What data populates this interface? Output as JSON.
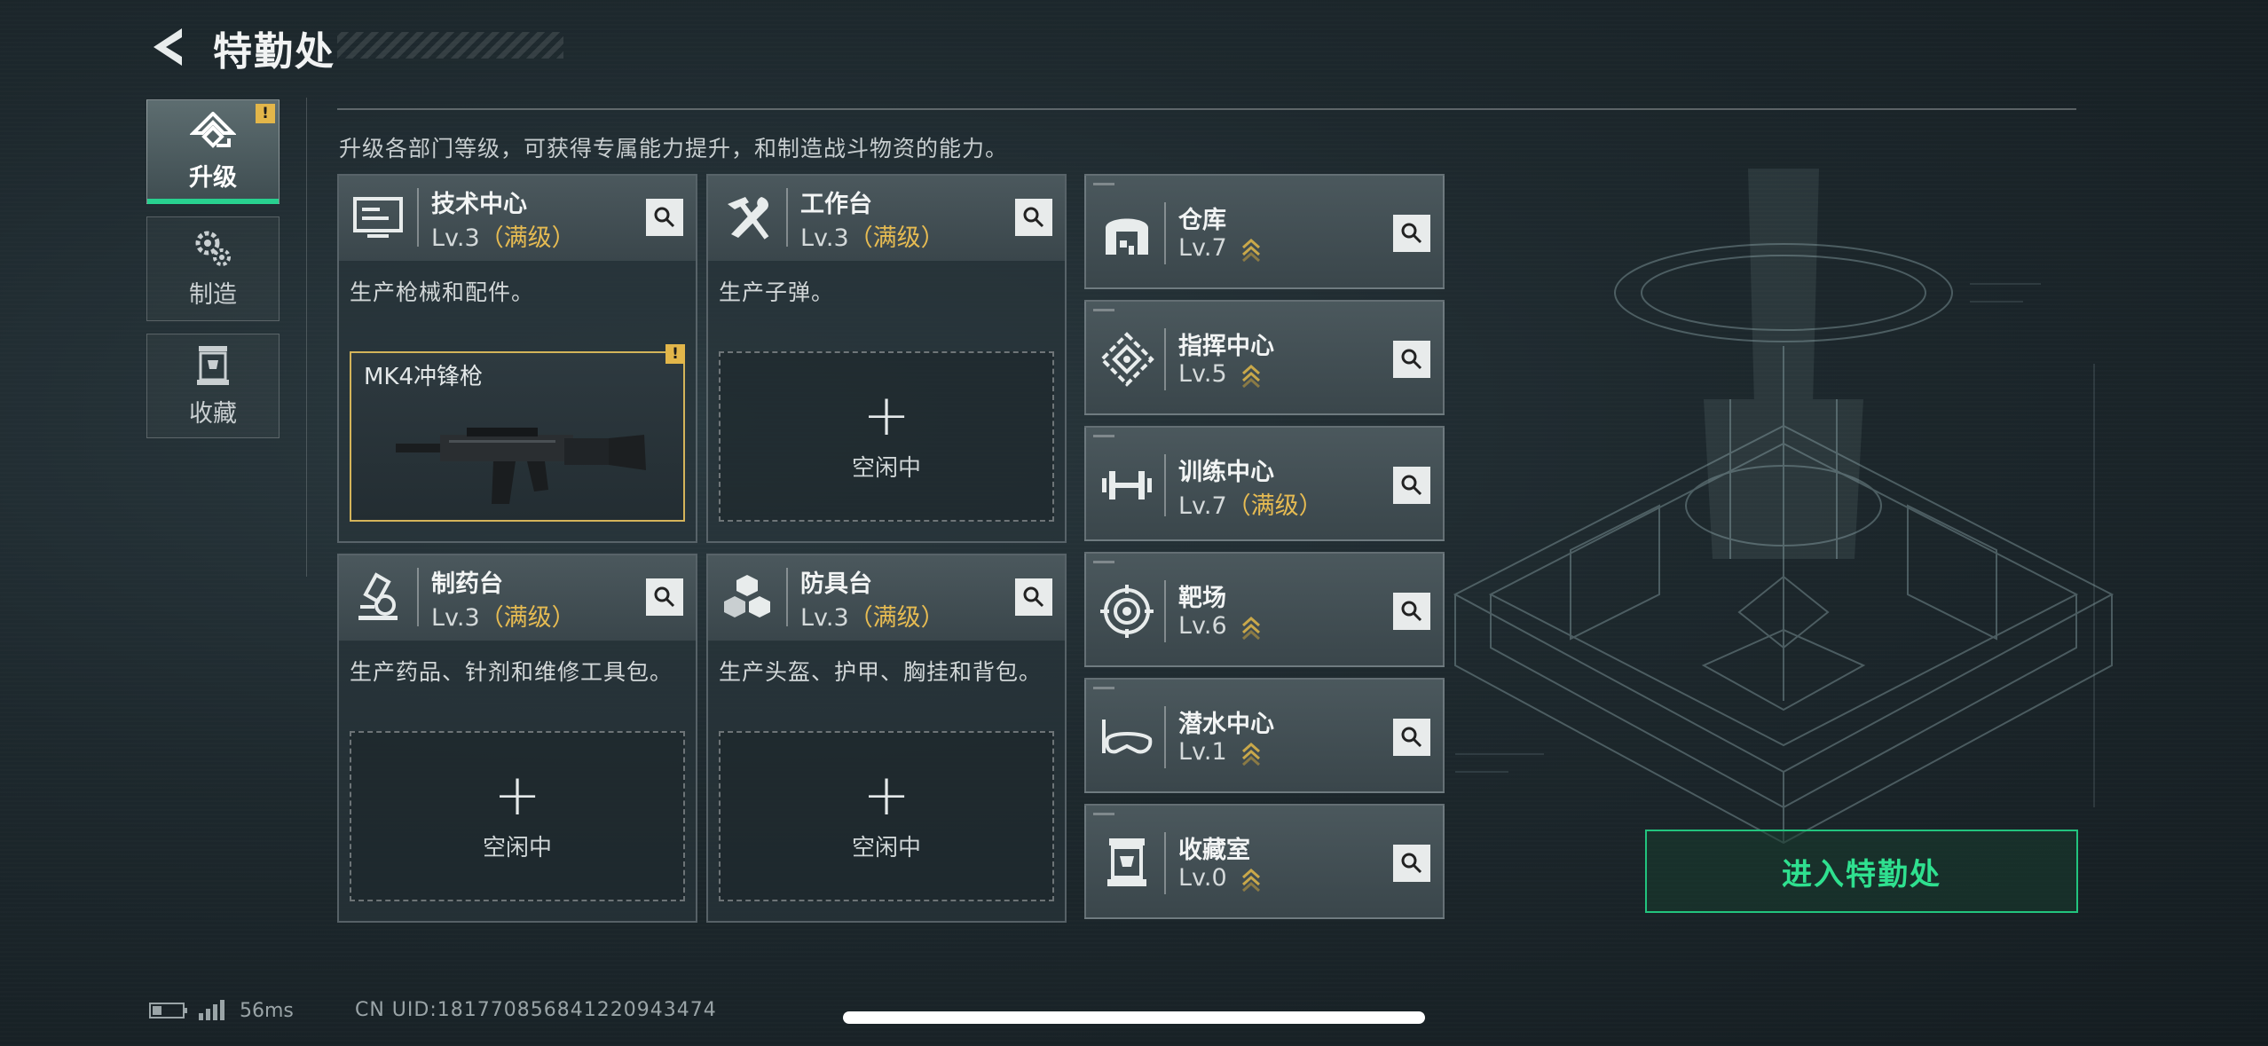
{
  "header": {
    "title": "特勤处"
  },
  "tabs": [
    {
      "label": "升级",
      "icon": "upgrade-icon",
      "active": true,
      "alert": "!"
    },
    {
      "label": "制造",
      "icon": "gears-icon",
      "active": false
    },
    {
      "label": "收藏",
      "icon": "trophy-case-icon",
      "active": false
    }
  ],
  "description": "升级各部门等级，可获得专属能力提升，和制造战斗物资的能力。",
  "departments": [
    {
      "name": "技术中心",
      "level": "Lv.3",
      "max": "（满级）",
      "desc": "生产枪械和配件。",
      "slot": {
        "item": "MK4冲锋枪",
        "alert": "!"
      }
    },
    {
      "name": "工作台",
      "level": "Lv.3",
      "max": "（满级）",
      "desc": "生产子弹。",
      "slot": {
        "label": "空闲中",
        "plus": "+"
      }
    },
    {
      "name": "制药台",
      "level": "Lv.3",
      "max": "（满级）",
      "desc": "生产药品、针剂和维修工具包。",
      "slot": {
        "label": "空闲中",
        "plus": "+"
      }
    },
    {
      "name": "防具台",
      "level": "Lv.3",
      "max": "（满级）",
      "desc": "生产头盔、护甲、胸挂和背包。",
      "slot": {
        "label": "空闲中",
        "plus": "+"
      }
    }
  ],
  "facilities": [
    {
      "name": "仓库",
      "level": "Lv.7",
      "max": "",
      "upgradable": true,
      "icon": "warehouse-icon"
    },
    {
      "name": "指挥中心",
      "level": "Lv.5",
      "max": "",
      "upgradable": true,
      "icon": "command-icon"
    },
    {
      "name": "训练中心",
      "level": "Lv.7",
      "max": "（满级）",
      "upgradable": false,
      "icon": "dumbbell-icon"
    },
    {
      "name": "靶场",
      "level": "Lv.6",
      "max": "",
      "upgradable": true,
      "icon": "target-icon"
    },
    {
      "name": "潜水中心",
      "level": "Lv.1",
      "max": "",
      "upgradable": true,
      "icon": "goggles-icon"
    },
    {
      "name": "收藏室",
      "level": "Lv.0",
      "max": "",
      "upgradable": true,
      "icon": "collection-icon"
    }
  ],
  "enter_button": "进入特勤处",
  "status": {
    "ping": "56ms",
    "uid": "CN UID:181770856841220943474"
  },
  "colors": {
    "accent": "#28d08f",
    "max_level": "#e6bb52",
    "alert": "#e2b64a"
  }
}
